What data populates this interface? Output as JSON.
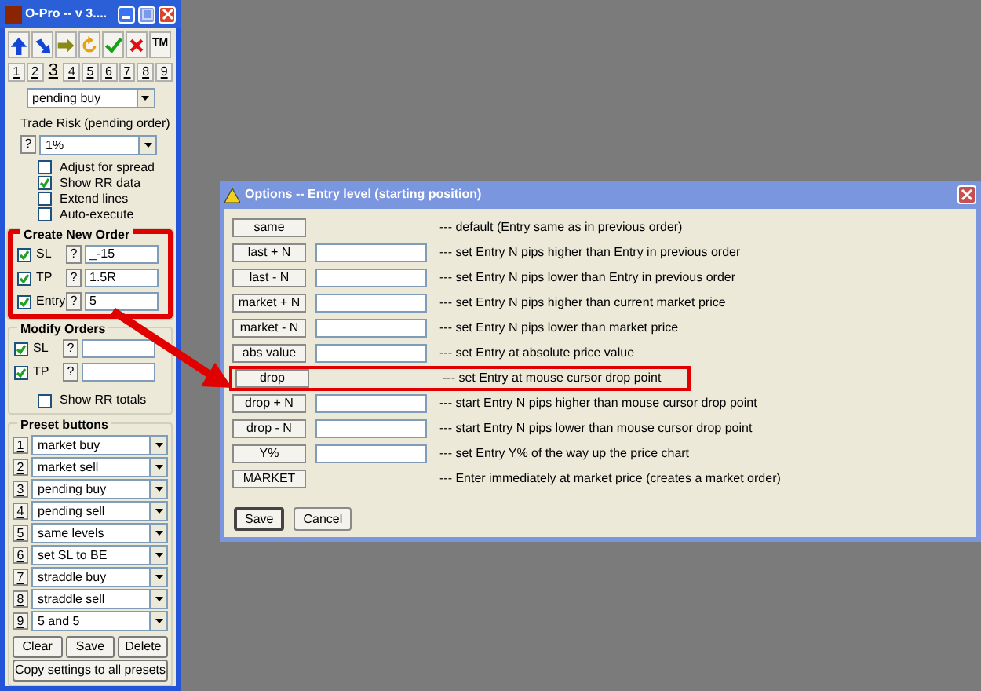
{
  "main_window": {
    "title": "O-Pro -- v 3....",
    "toolbar": [
      {
        "kind": "up"
      },
      {
        "kind": "down-right"
      },
      {
        "kind": "right"
      },
      {
        "kind": "refresh"
      },
      {
        "kind": "check"
      },
      {
        "kind": "cross"
      },
      {
        "kind": "text",
        "label": "TM"
      }
    ],
    "number_tabs": [
      {
        "label": "1",
        "selected": false
      },
      {
        "label": "2",
        "selected": false
      },
      {
        "label": "3",
        "selected": true
      },
      {
        "label": "4",
        "selected": false
      },
      {
        "label": "5",
        "selected": false
      },
      {
        "label": "6",
        "selected": false
      },
      {
        "label": "7",
        "selected": false
      },
      {
        "label": "8",
        "selected": false
      },
      {
        "label": "9",
        "selected": false
      }
    ],
    "order_type": {
      "value": "pending buy"
    },
    "trade_risk": {
      "label": "Trade Risk (pending order)",
      "help": "?",
      "value": "1%"
    },
    "options": [
      {
        "label": "Adjust for spread",
        "checked": false
      },
      {
        "label": "Show RR data",
        "checked": true
      },
      {
        "label": "Extend lines",
        "checked": false
      },
      {
        "label": "Auto-execute",
        "checked": false
      }
    ],
    "create_new_order": {
      "title": "Create New Order",
      "highlighted": true,
      "rows": [
        {
          "label": "SL",
          "checked": true,
          "help": "?",
          "value": "_-15"
        },
        {
          "label": "TP",
          "checked": true,
          "help": "?",
          "value": "1.5R"
        },
        {
          "label": "Entry",
          "checked": true,
          "help": "?",
          "value": "5"
        }
      ]
    },
    "modify_orders": {
      "title": "Modify Orders",
      "rows": [
        {
          "label": "SL",
          "checked": true,
          "help": "?"
        },
        {
          "label": "TP",
          "checked": true,
          "help": "?"
        }
      ],
      "show_rr_totals": {
        "label": "Show RR totals",
        "checked": false
      }
    },
    "presets": {
      "title": "Preset buttons",
      "items": [
        {
          "number": "1",
          "value": "market buy"
        },
        {
          "number": "2",
          "value": "market sell"
        },
        {
          "number": "3",
          "value": "pending buy"
        },
        {
          "number": "4",
          "value": "pending sell"
        },
        {
          "number": "5",
          "value": "same levels"
        },
        {
          "number": "6",
          "value": "set SL to BE"
        },
        {
          "number": "7",
          "value": "straddle buy"
        },
        {
          "number": "8",
          "value": "straddle sell"
        },
        {
          "number": "9",
          "value": "5 and 5"
        }
      ],
      "buttons": [
        "Clear",
        "Save",
        "Delete"
      ],
      "copy_button": "Copy settings to all presets"
    }
  },
  "dialog": {
    "title": "Options -- Entry level (starting position)",
    "options": [
      {
        "button": "same",
        "kind": "plain",
        "highlighted": false,
        "description": "--- default (Entry same as in previous order)"
      },
      {
        "button": "last + N",
        "kind": "input",
        "highlighted": false,
        "description": "--- set Entry N pips higher than Entry in previous order"
      },
      {
        "button": "last - N",
        "kind": "input",
        "highlighted": false,
        "description": "--- set Entry N pips lower than Entry in previous order"
      },
      {
        "button": "market + N",
        "kind": "input",
        "highlighted": false,
        "description": "--- set Entry N pips higher than current market price"
      },
      {
        "button": "market - N",
        "kind": "input",
        "highlighted": false,
        "description": "--- set Entry N pips lower than market price"
      },
      {
        "button": "abs value",
        "kind": "input",
        "highlighted": false,
        "description": "--- set Entry at absolute price value"
      },
      {
        "button": "drop",
        "kind": "plain",
        "highlighted": true,
        "description": "--- set Entry at mouse cursor drop point"
      },
      {
        "button": "drop + N",
        "kind": "input",
        "highlighted": false,
        "description": "--- start Entry N pips higher than mouse cursor drop point"
      },
      {
        "button": "drop - N",
        "kind": "input",
        "highlighted": false,
        "description": "--- start Entry N pips lower than mouse cursor drop point"
      },
      {
        "button": "Y%",
        "kind": "input",
        "highlighted": false,
        "description": "--- set Entry Y% of the way up the price chart"
      },
      {
        "button": "MARKET",
        "kind": "plain",
        "highlighted": false,
        "description": "--- Enter immediately at market price (creates a market order)"
      }
    ],
    "buttons": [
      {
        "label": "Save",
        "default": true
      },
      {
        "label": "Cancel",
        "default": false
      }
    ]
  }
}
